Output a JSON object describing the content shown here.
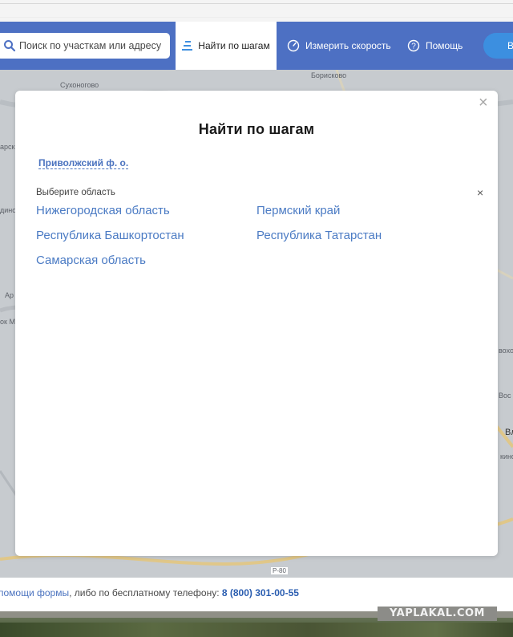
{
  "colors": {
    "nav_bg": "#4d70c3",
    "accent_link": "#4b7bc4",
    "button": "#3c8fe0"
  },
  "header": {
    "search_placeholder": "Поиск по участкам или адресу",
    "search_icon": "search-icon",
    "tab_steps_label": "Найти по шагам",
    "tab_steps_icon": "steps-list-icon",
    "speed_label": "Измерить скорость",
    "speed_icon": "speedometer-icon",
    "help_label": "Помощь",
    "help_icon": "question-circle-icon",
    "cut_button_label": "В"
  },
  "map": {
    "labels": [
      "Сухоногово",
      "Борисково",
      "арск",
      "дино",
      "Ар",
      "ок М",
      "Р-80",
      "вохово",
      "Вос",
      "Вл",
      "кино"
    ]
  },
  "modal": {
    "title": "Найти по шагам",
    "breadcrumb": "Приволжский ф. о.",
    "subtitle": "Выберите область",
    "close_symbol": "×",
    "sub_close_symbol": "×",
    "regions": [
      "Нижегородская область",
      "Пермский край",
      "Республика Башкортостан",
      "Республика Татарстан",
      "Самарская область"
    ]
  },
  "footer": {
    "link_text": "помощи формы",
    "middle_text": ", либо по бесплатному телефону: ",
    "phone": "8 (800) 301-00-55"
  },
  "watermark": "YAPLAKAL.COM"
}
